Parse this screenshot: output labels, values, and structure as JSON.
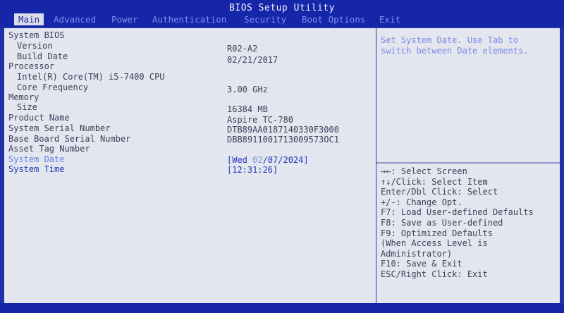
{
  "header": {
    "title": "BIOS Setup Utility",
    "tabs": [
      "Main",
      "Advanced",
      "Power",
      "Authentication",
      "Security",
      "Boot Options",
      "Exit"
    ],
    "active_tab": "Main"
  },
  "main": {
    "system_bios_label": "System BIOS",
    "version_label": "Version",
    "version_value": "R02-A2",
    "build_date_label": "Build Date",
    "build_date_value": "02/21/2017",
    "processor_label": "Processor",
    "cpu_name": "Intel(R) Core(TM) i5-7400 CPU",
    "core_freq_label": "Core Frequency",
    "core_freq_value": "3.00 GHz",
    "memory_label": "Memory",
    "size_label": "Size",
    "size_value": "16384 MB",
    "product_name_label": "Product Name",
    "product_name_value": "Aspire TC-780",
    "serial_label": "System Serial Number",
    "serial_value": "DTB89AA0187140330F3000",
    "bb_serial_label": "Base Board Serial Number",
    "bb_serial_value": "DBB8911001713009573OC1",
    "asset_tag_label": "Asset Tag Number",
    "system_date_label": "System Date",
    "system_date_prefix": "[Wed ",
    "system_date_highlight": "02",
    "system_date_rest": "/07/2024]",
    "system_time_label": "System Time",
    "system_time_value": "[12:31:26]"
  },
  "help": {
    "text_line1": "Set System Date. Use Tab to",
    "text_line2": "switch between Date elements.",
    "keys": [
      "→←: Select Screen",
      "↑↓/Click: Select Item",
      "Enter/Dbl Click: Select",
      "+/-: Change Opt.",
      "F7: Load User-defined Defaults",
      "F8: Save as User-defined",
      "F9: Optimized Defaults",
      "(When Access Level is",
      "Administrator)",
      "F10: Save & Exit",
      "ESC/Right Click: Exit"
    ]
  }
}
